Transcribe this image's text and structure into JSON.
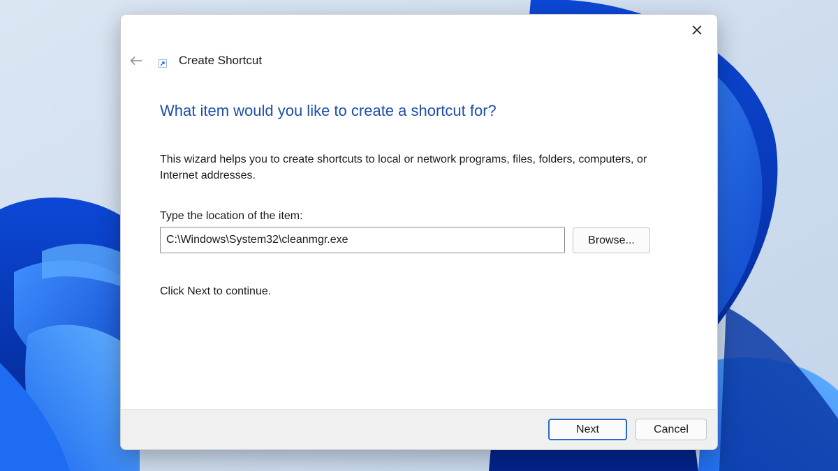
{
  "window": {
    "title": "Create Shortcut",
    "close_icon": "close-icon",
    "back_icon": "back-arrow-icon",
    "title_icon": "shortcut-icon"
  },
  "content": {
    "heading": "What item would you like to create a shortcut for?",
    "description": "This wizard helps you to create shortcuts to local or network programs, files, folders, computers, or Internet addresses.",
    "location_label": "Type the location of the item:",
    "location_value": "C:\\Windows\\System32\\cleanmgr.exe",
    "browse_label": "Browse...",
    "continue_text": "Click Next to continue."
  },
  "footer": {
    "next_label": "Next",
    "cancel_label": "Cancel"
  },
  "colors": {
    "heading": "#1b4fa8",
    "accent": "#2a68c9",
    "footer_bg": "#f0f0f0",
    "desktop_bg": "#cfdcec"
  }
}
